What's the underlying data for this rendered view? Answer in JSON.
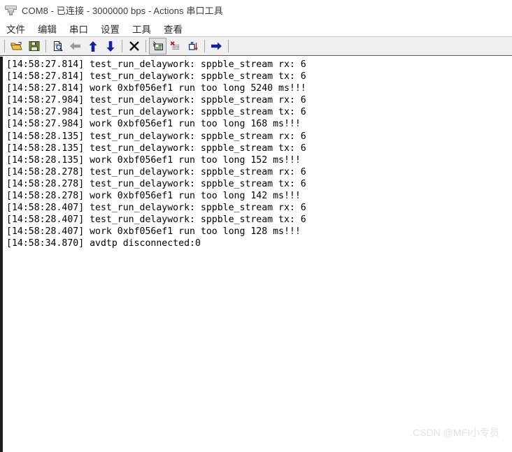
{
  "window": {
    "title": "COM8 - 已连接 - 3000000 bps - Actions 串口工具",
    "icon": "serial-plug-icon"
  },
  "menubar": {
    "items": [
      {
        "label": "文件",
        "name": "menu-file"
      },
      {
        "label": "编辑",
        "name": "menu-edit"
      },
      {
        "label": "串口",
        "name": "menu-serial-port"
      },
      {
        "label": "设置",
        "name": "menu-settings"
      },
      {
        "label": "工具",
        "name": "menu-tools"
      },
      {
        "label": "查看",
        "name": "menu-view"
      }
    ]
  },
  "toolbar": {
    "buttons": [
      {
        "name": "open-file-icon",
        "title": "打开",
        "active": false
      },
      {
        "name": "save-file-icon",
        "title": "保存",
        "active": false
      },
      {
        "name": "print-preview-icon",
        "title": "打印预览",
        "active": false
      },
      {
        "name": "arrow-left-icon",
        "title": "后退",
        "active": false
      },
      {
        "name": "arrow-up-icon",
        "title": "向上",
        "active": false
      },
      {
        "name": "arrow-down-icon",
        "title": "向下",
        "active": false
      },
      {
        "name": "close-x-icon",
        "title": "关闭",
        "active": false
      },
      {
        "name": "insert-note-icon",
        "title": "插入标记",
        "active": true
      },
      {
        "name": "clear-grid-icon",
        "title": "清除",
        "active": false
      },
      {
        "name": "export-down-icon",
        "title": "导出",
        "active": false
      },
      {
        "name": "arrow-right-icon",
        "title": "前进",
        "active": false
      }
    ]
  },
  "log": {
    "lines": [
      "[14:58:27.814] test_run_delaywork: sppble_stream rx: 6",
      "[14:58:27.814] test_run_delaywork: sppble_stream tx: 6",
      "[14:58:27.814] work 0xbf056ef1 run too long 5240 ms!!!",
      "[14:58:27.984] test_run_delaywork: sppble_stream rx: 6",
      "[14:58:27.984] test_run_delaywork: sppble_stream tx: 6",
      "[14:58:27.984] work 0xbf056ef1 run too long 168 ms!!!",
      "[14:58:28.135] test_run_delaywork: sppble_stream rx: 6",
      "[14:58:28.135] test_run_delaywork: sppble_stream tx: 6",
      "[14:58:28.135] work 0xbf056ef1 run too long 152 ms!!!",
      "[14:58:28.278] test_run_delaywork: sppble_stream rx: 6",
      "[14:58:28.278] test_run_delaywork: sppble_stream tx: 6",
      "[14:58:28.278] work 0xbf056ef1 run too long 142 ms!!!",
      "[14:58:28.407] test_run_delaywork: sppble_stream rx: 6",
      "[14:58:28.407] test_run_delaywork: sppble_stream tx: 6",
      "[14:58:28.407] work 0xbf056ef1 run too long 128 ms!!!",
      "[14:58:34.870] avdtp disconnected:0"
    ]
  },
  "watermark": {
    "text": "CSDN @MFI小专员"
  },
  "colors": {
    "titlebar_bg": "#ffffff",
    "toolbar_bg": "#f0f0f0",
    "log_bg": "#ffffff",
    "log_text": "#000000",
    "accent_blue": "#1a2fa0",
    "watermark": "#e2e2e2"
  }
}
